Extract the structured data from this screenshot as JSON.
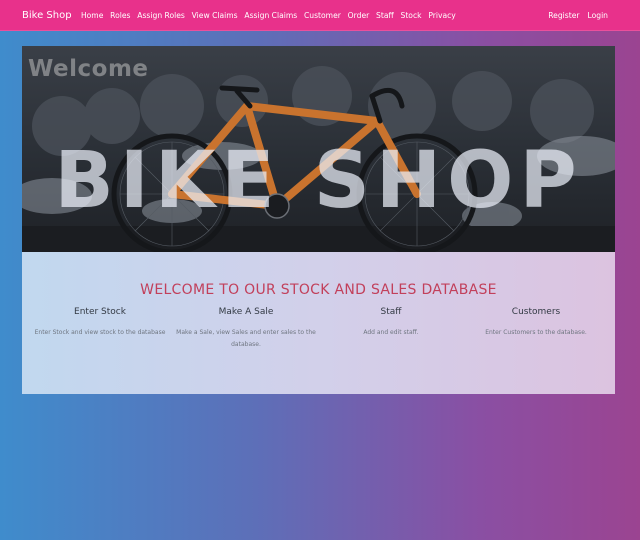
{
  "navbar": {
    "brand": "Bike Shop",
    "links": [
      "Home",
      "Roles",
      "Assign Roles",
      "View Claims",
      "Assign Claims",
      "Customer",
      "Order",
      "Staff",
      "Stock",
      "Privacy"
    ],
    "right_links": [
      "Register",
      "Login"
    ],
    "color": "#e8318b"
  },
  "hero": {
    "welcome_text": "Welcome",
    "overlay_text": "BIKE SHOP"
  },
  "panel": {
    "title": "WELCOME TO OUR STOCK AND SALES DATABASE",
    "columns": [
      {
        "heading": "Enter Stock",
        "text": "Enter Stock and view stock to the database"
      },
      {
        "heading": "Make A Sale",
        "text": "Make a Sale, view Sales and enter sales to the database."
      },
      {
        "heading": "Staff",
        "text": "Add and edit staff."
      },
      {
        "heading": "Customers",
        "text": "Enter Customers to the database."
      }
    ]
  }
}
